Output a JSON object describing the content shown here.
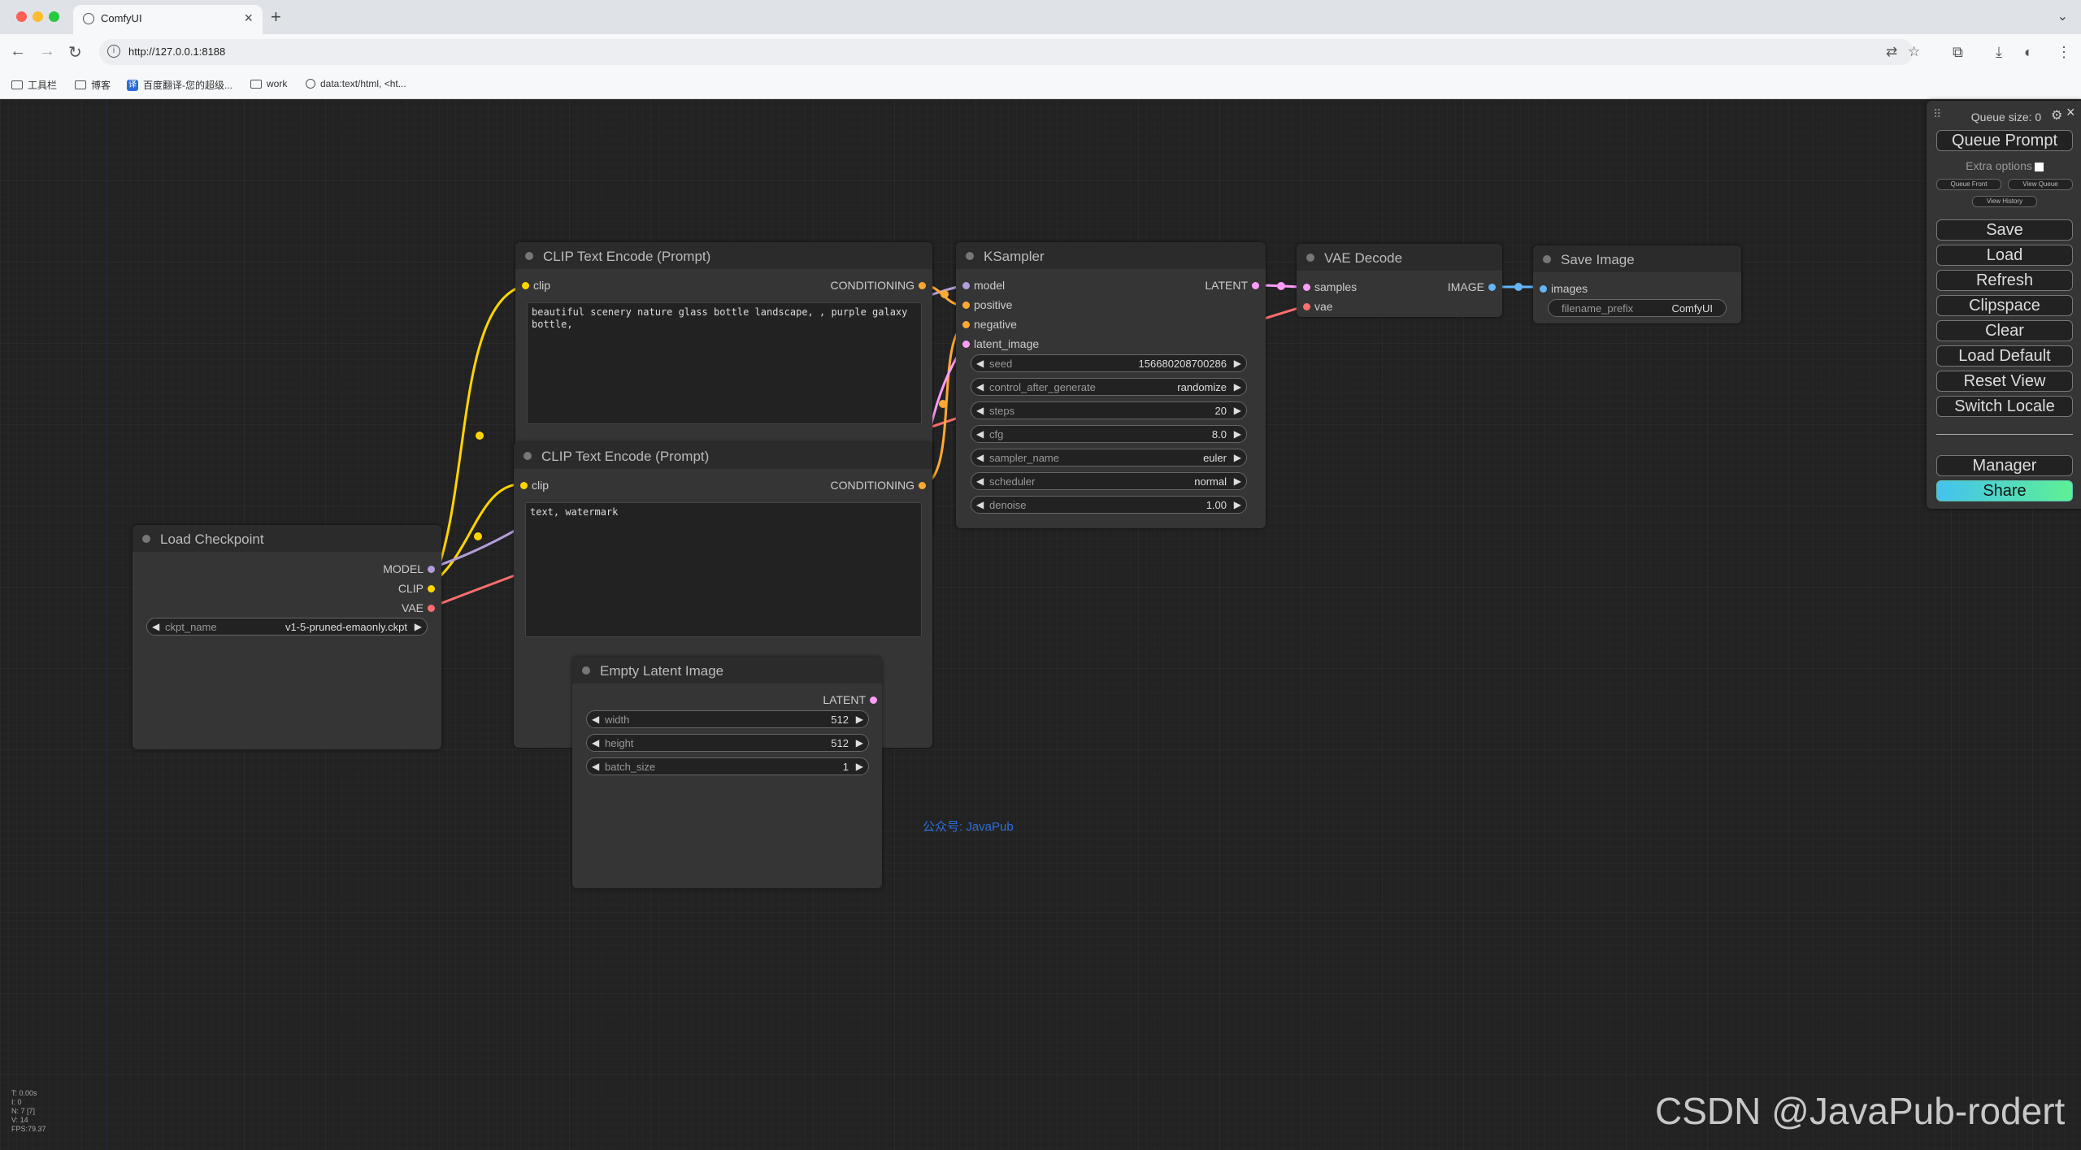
{
  "browser": {
    "tab_title": "ComfyUI",
    "url": "http://127.0.0.1:8188",
    "bookmarks": [
      "工具栏",
      "博客",
      "百度翻译-您的超级...",
      "work",
      "data:text/html, <ht..."
    ]
  },
  "nodes": {
    "clip_pos": {
      "title": "CLIP Text Encode (Prompt)",
      "input": "clip",
      "output": "CONDITIONING",
      "text": "beautiful scenery nature glass bottle landscape, , purple galaxy bottle,"
    },
    "clip_neg": {
      "title": "CLIP Text Encode (Prompt)",
      "input": "clip",
      "output": "CONDITIONING",
      "text": "text, watermark"
    },
    "ksampler": {
      "title": "KSampler",
      "inputs": [
        "model",
        "positive",
        "negative",
        "latent_image"
      ],
      "output": "LATENT",
      "widgets": [
        {
          "name": "seed",
          "value": "156680208700286"
        },
        {
          "name": "control_after_generate",
          "value": "randomize"
        },
        {
          "name": "steps",
          "value": "20"
        },
        {
          "name": "cfg",
          "value": "8.0"
        },
        {
          "name": "sampler_name",
          "value": "euler"
        },
        {
          "name": "scheduler",
          "value": "normal"
        },
        {
          "name": "denoise",
          "value": "1.00"
        }
      ]
    },
    "vae_decode": {
      "title": "VAE Decode",
      "inputs": [
        "samples",
        "vae"
      ],
      "output": "IMAGE"
    },
    "save_image": {
      "title": "Save Image",
      "input": "images",
      "widget_name": "filename_prefix",
      "widget_value": "ComfyUI"
    },
    "load_checkpoint": {
      "title": "Load Checkpoint",
      "outputs": [
        "MODEL",
        "CLIP",
        "VAE"
      ],
      "widget_name": "ckpt_name",
      "widget_value": "v1-5-pruned-emaonly.ckpt"
    },
    "empty_latent": {
      "title": "Empty Latent Image",
      "output": "LATENT",
      "widgets": [
        {
          "name": "width",
          "value": "512"
        },
        {
          "name": "height",
          "value": "512"
        },
        {
          "name": "batch_size",
          "value": "1"
        }
      ]
    }
  },
  "menu": {
    "queue_size": "Queue size: 0",
    "queue_prompt": "Queue Prompt",
    "extra_options": "Extra options",
    "queue_front": "Queue Front",
    "view_queue": "View Queue",
    "view_history": "View History",
    "buttons": [
      "Save",
      "Load",
      "Refresh",
      "Clipspace",
      "Clear",
      "Load Default",
      "Reset View",
      "Switch Locale"
    ],
    "manager": "Manager",
    "share": "Share"
  },
  "stats": [
    "T: 0.00s",
    "I: 0",
    "N: 7 [7]",
    "V: 14",
    "FPS:79.37"
  ],
  "annotation": "公众号: JavaPub",
  "watermark": "CSDN @JavaPub-rodert",
  "colors": {
    "clip": "#ffd500",
    "conditioning": "#ffa931",
    "model": "#b39ddb",
    "latent": "#ff9cf9",
    "vae": "#ff6e6e",
    "image": "#64b5f6"
  }
}
